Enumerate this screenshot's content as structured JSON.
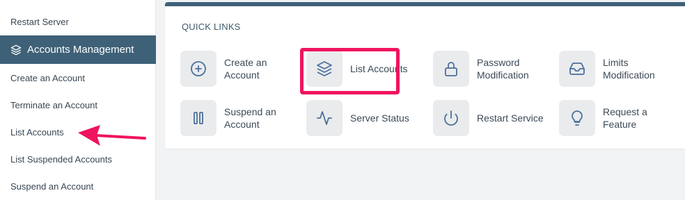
{
  "sidebar": {
    "items": [
      {
        "label": "Restart Server"
      },
      {
        "label": "Accounts Management",
        "icon": "layers-icon",
        "active": true
      },
      {
        "label": "Create an Account"
      },
      {
        "label": "Terminate an Account"
      },
      {
        "label": "List Accounts"
      },
      {
        "label": "List Suspended Accounts"
      },
      {
        "label": "Suspend an Account"
      }
    ]
  },
  "quick_links": {
    "title": "QUICK LINKS",
    "items": [
      {
        "label": "Create an Account",
        "icon": "plus-circle-icon"
      },
      {
        "label": "List Accounts",
        "icon": "layers-icon",
        "highlighted": true
      },
      {
        "label": "Password Modification",
        "icon": "lock-icon"
      },
      {
        "label": "Limits Modification",
        "icon": "inbox-icon"
      },
      {
        "label": "Suspend an Account",
        "icon": "pause-icon"
      },
      {
        "label": "Server Status",
        "icon": "activity-icon"
      },
      {
        "label": "Restart Service",
        "icon": "power-icon"
      },
      {
        "label": "Request a Feature",
        "icon": "lightbulb-icon"
      }
    ]
  },
  "colors": {
    "accent": "#3e6178",
    "highlight": "#f0135f",
    "icon": "#4a6f9a"
  }
}
